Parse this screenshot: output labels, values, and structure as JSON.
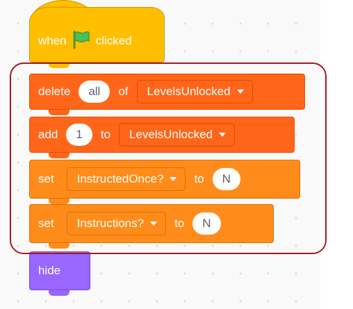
{
  "hat": {
    "when": "when",
    "clicked": "clicked",
    "flag_icon": "green-flag-icon"
  },
  "delete_block": {
    "verb": "delete",
    "item": "all",
    "of": "of",
    "list": "LevelsUnlocked"
  },
  "add_block": {
    "verb": "add",
    "item": "1",
    "to": "to",
    "list": "LevelsUnlocked"
  },
  "set_block_1": {
    "verb": "set",
    "variable": "InstructedOnce?",
    "to": "to",
    "value": "N"
  },
  "set_block_2": {
    "verb": "set",
    "variable": "Instructions?",
    "to": "to",
    "value": "N"
  },
  "hide_block": {
    "label": "hide"
  },
  "colors": {
    "events": "#ffbf00",
    "lists": "#ff661a",
    "variables": "#ff8c1a",
    "looks": "#9966ff",
    "highlight": "#a11a26",
    "flag": "#4cbf56"
  }
}
